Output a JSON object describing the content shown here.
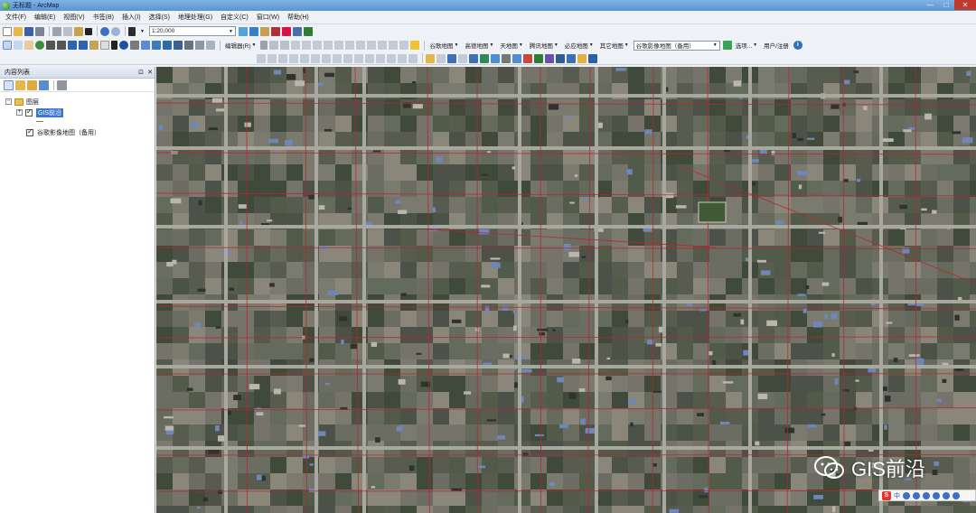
{
  "window": {
    "title": "无标题 - ArcMap"
  },
  "menu": [
    "文件(F)",
    "编辑(E)",
    "视图(V)",
    "书签(B)",
    "插入(I)",
    "选择(S)",
    "地理处理(G)",
    "自定义(C)",
    "窗口(W)",
    "帮助(H)"
  ],
  "toolbar": {
    "scale": "1:20,000",
    "editor_label": "编辑器(R)",
    "map_menus": [
      "谷歌地图",
      "高德地图",
      "天地图",
      "腾讯地图",
      "必应地图",
      "其它地图"
    ],
    "google_label": "谷歌影像地图（备用）",
    "google_combo_value": "谷歌影像地图（备用）",
    "options_label": "选项...",
    "login_label": "用户/注册"
  },
  "toc": {
    "title": "内容列表",
    "group": "图层",
    "layers": [
      {
        "name": "GIS前沿",
        "checked": true,
        "selected": true
      },
      {
        "name": "谷歌影像地图（备用）",
        "checked": true,
        "selected": false
      }
    ]
  },
  "watermark": "GIS前沿",
  "tray": {
    "ime": "中"
  },
  "colors": {
    "titlebar": "#5b93d1",
    "selection": "#3a78d0",
    "vector_lines": "#b8262e"
  }
}
